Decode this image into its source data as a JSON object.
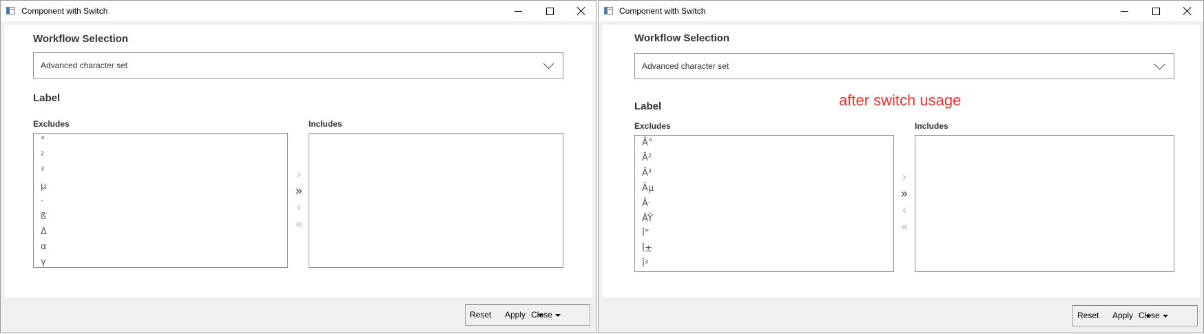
{
  "left_window": {
    "title": "Component with Switch",
    "workflow_label": "Workflow Selection",
    "workflow_value": "Advanced character set",
    "label_heading": "Label",
    "excludes_label": "Excludes",
    "includes_label": "Includes",
    "excludes_items": [
      "°",
      "²",
      "³",
      "µ",
      "·",
      "ß",
      "Δ",
      "α",
      "γ"
    ],
    "includes_items": [],
    "transfer": {
      "move_right": "›",
      "move_all_right": "»",
      "move_left": "‹",
      "move_all_left": "«"
    },
    "footer": {
      "reset": "Reset",
      "apply": "Apply",
      "close": "Close"
    }
  },
  "right_window": {
    "title": "Component with Switch",
    "workflow_label": "Workflow Selection",
    "workflow_value": "Advanced character set",
    "label_heading": "Label",
    "excludes_label": "Excludes",
    "includes_label": "Includes",
    "excludes_items": [
      "Â°",
      "Â²",
      "Â³",
      "Âµ",
      "Â·",
      "ÃŸ",
      "Î”",
      "Î±",
      "Î³"
    ],
    "includes_items": [],
    "annotation": "after switch usage",
    "transfer": {
      "move_right": "›",
      "move_all_right": "»",
      "move_left": "‹",
      "move_all_left": "«"
    },
    "footer": {
      "reset": "Reset",
      "apply": "Apply",
      "close": "Close"
    }
  },
  "colors": {
    "annotation": "#ff2d2d",
    "active_arrow": "#444444",
    "disabled_arrow": "#b8b8b8"
  }
}
